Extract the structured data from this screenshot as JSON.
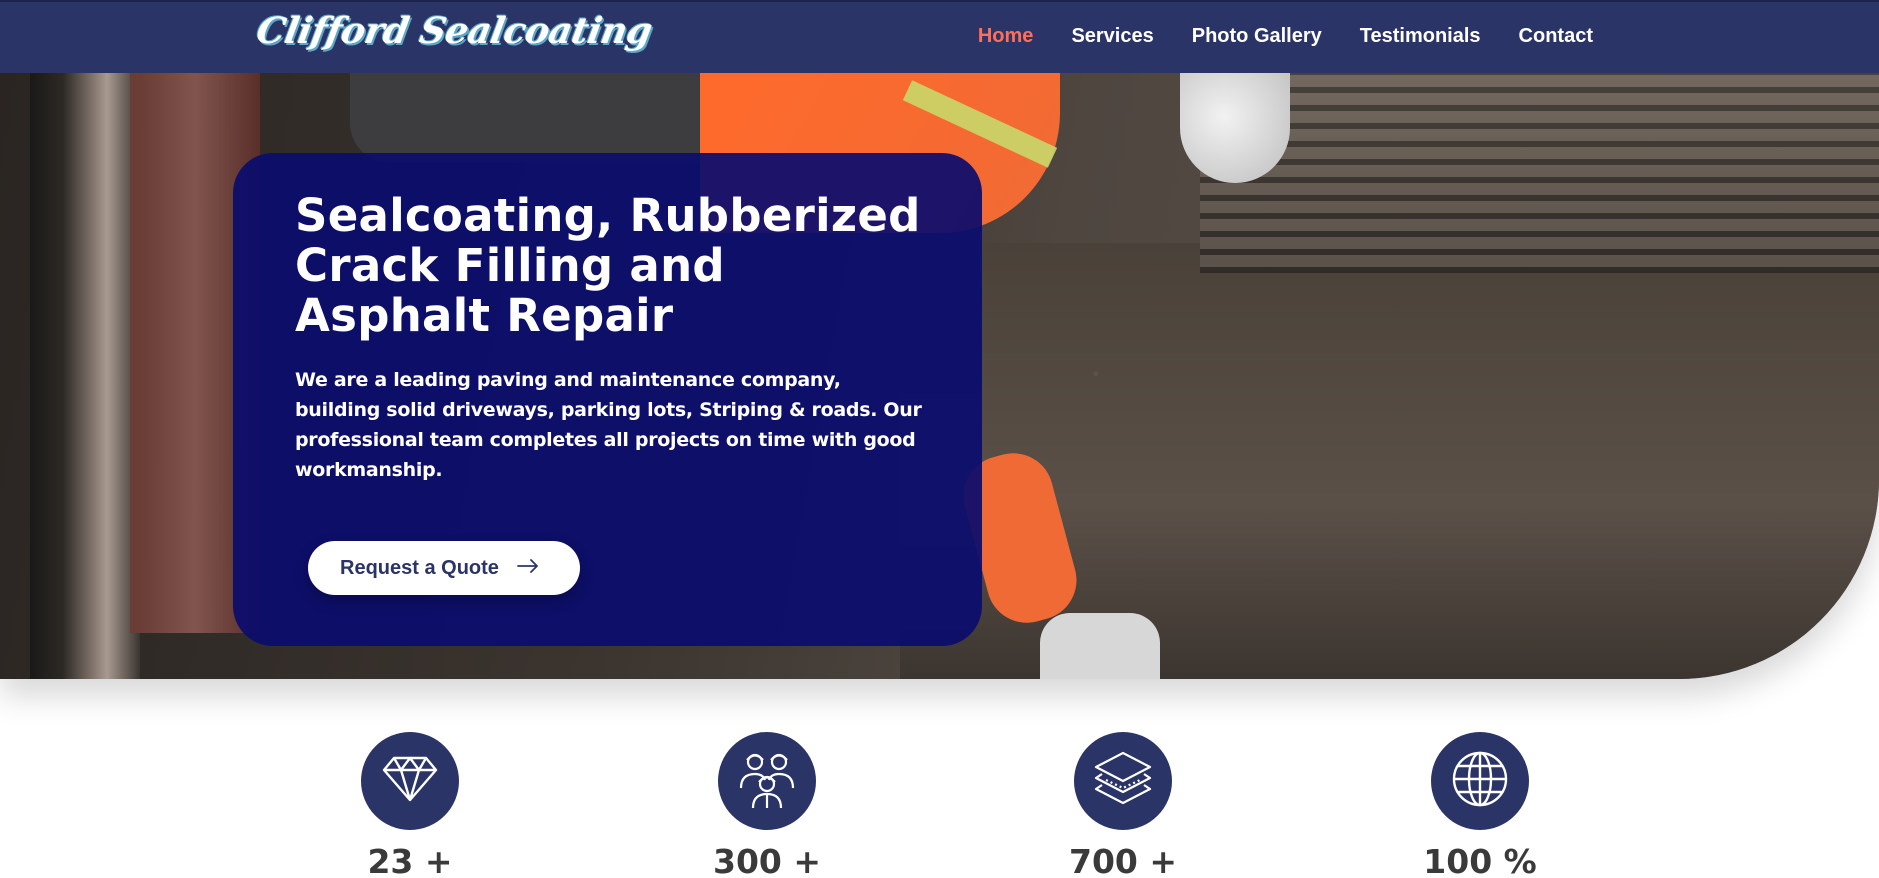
{
  "brand": {
    "logo": "Clifford Sealcoating"
  },
  "nav": {
    "items": [
      {
        "label": "Home",
        "active": true
      },
      {
        "label": "Services",
        "active": false
      },
      {
        "label": "Photo Gallery",
        "active": false
      },
      {
        "label": "Testimonials",
        "active": false
      },
      {
        "label": "Contact",
        "active": false
      }
    ]
  },
  "hero": {
    "title": "Sealcoating, Rubberized Crack Filling and Asphalt Repair",
    "text": "We are a leading paving and maintenance company, building solid driveways, parking lots, Striping & roads. Our professional team completes all projects on time with good workmanship.",
    "cta_label": "Request a Quote",
    "cta_icon": "arrow-right-icon"
  },
  "stats": [
    {
      "icon": "diamond-icon",
      "value": "23 +"
    },
    {
      "icon": "team-icon",
      "value": "300 +"
    },
    {
      "icon": "layers-icon",
      "value": "700 +"
    },
    {
      "icon": "globe-icon",
      "value": "100 %"
    }
  ],
  "colors": {
    "nav_bg": "#2b3467",
    "active_link": "#ff6f56",
    "hero_card": "#0a0c6e",
    "stat_circle": "#2b3467"
  }
}
